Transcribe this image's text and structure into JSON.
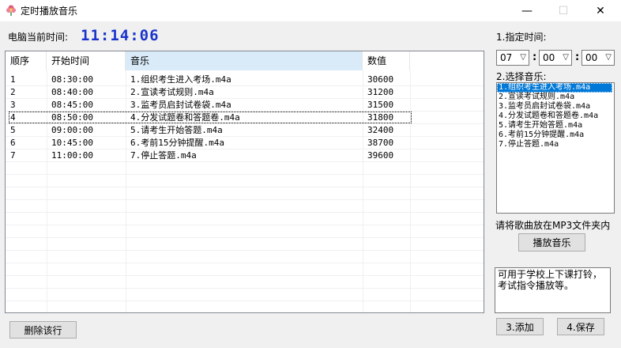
{
  "window": {
    "title": "定时播放音乐",
    "min_glyph": "—",
    "max_glyph": "☐",
    "close_glyph": "✕"
  },
  "clock": {
    "label": "电脑当前时间:",
    "value": "11:14:06",
    "color": "#1a33cc"
  },
  "table": {
    "headers": [
      "顺序",
      "开始时间",
      "音乐",
      "数值"
    ],
    "rows": [
      [
        "1",
        "08:30:00",
        "1.组织考生进入考场.m4a",
        "30600"
      ],
      [
        "2",
        "08:40:00",
        "2.宣读考试规则.m4a",
        "31200"
      ],
      [
        "3",
        "08:45:00",
        "3.监考员启封试卷袋.m4a",
        "31500"
      ],
      [
        "4",
        "08:50:00",
        "4.分发试题卷和答题卷.m4a",
        "31800"
      ],
      [
        "5",
        "09:00:00",
        "5.请考生开始答题.m4a",
        "32400"
      ],
      [
        "6",
        "10:45:00",
        "6.考前15分钟提醒.m4a",
        "38700"
      ],
      [
        "7",
        "11:00:00",
        "7.停止答题.m4a",
        "39600"
      ]
    ]
  },
  "delete_button": "删除该行",
  "right": {
    "time_label": "1.指定时间:",
    "hour": "07",
    "minute": "00",
    "second": "00",
    "colon": ":",
    "music_label": "2.选择音乐:",
    "music_list": [
      "1.组织考生进入考场.m4a",
      "2.宣读考试规则.m4a",
      "3.监考员启封试卷袋.m4a",
      "4.分发试题卷和答题卷.m4a",
      "5.请考生开始答题.m4a",
      "6.考前15分钟提醒.m4a",
      "7.停止答题.m4a"
    ],
    "hint": "请将歌曲放在MP3文件夹内",
    "play_button": "播放音乐",
    "memo": "可用于学校上下课打铃，\n考试指令播放等。",
    "add_button": "3.添加",
    "save_button": "4.保存"
  }
}
